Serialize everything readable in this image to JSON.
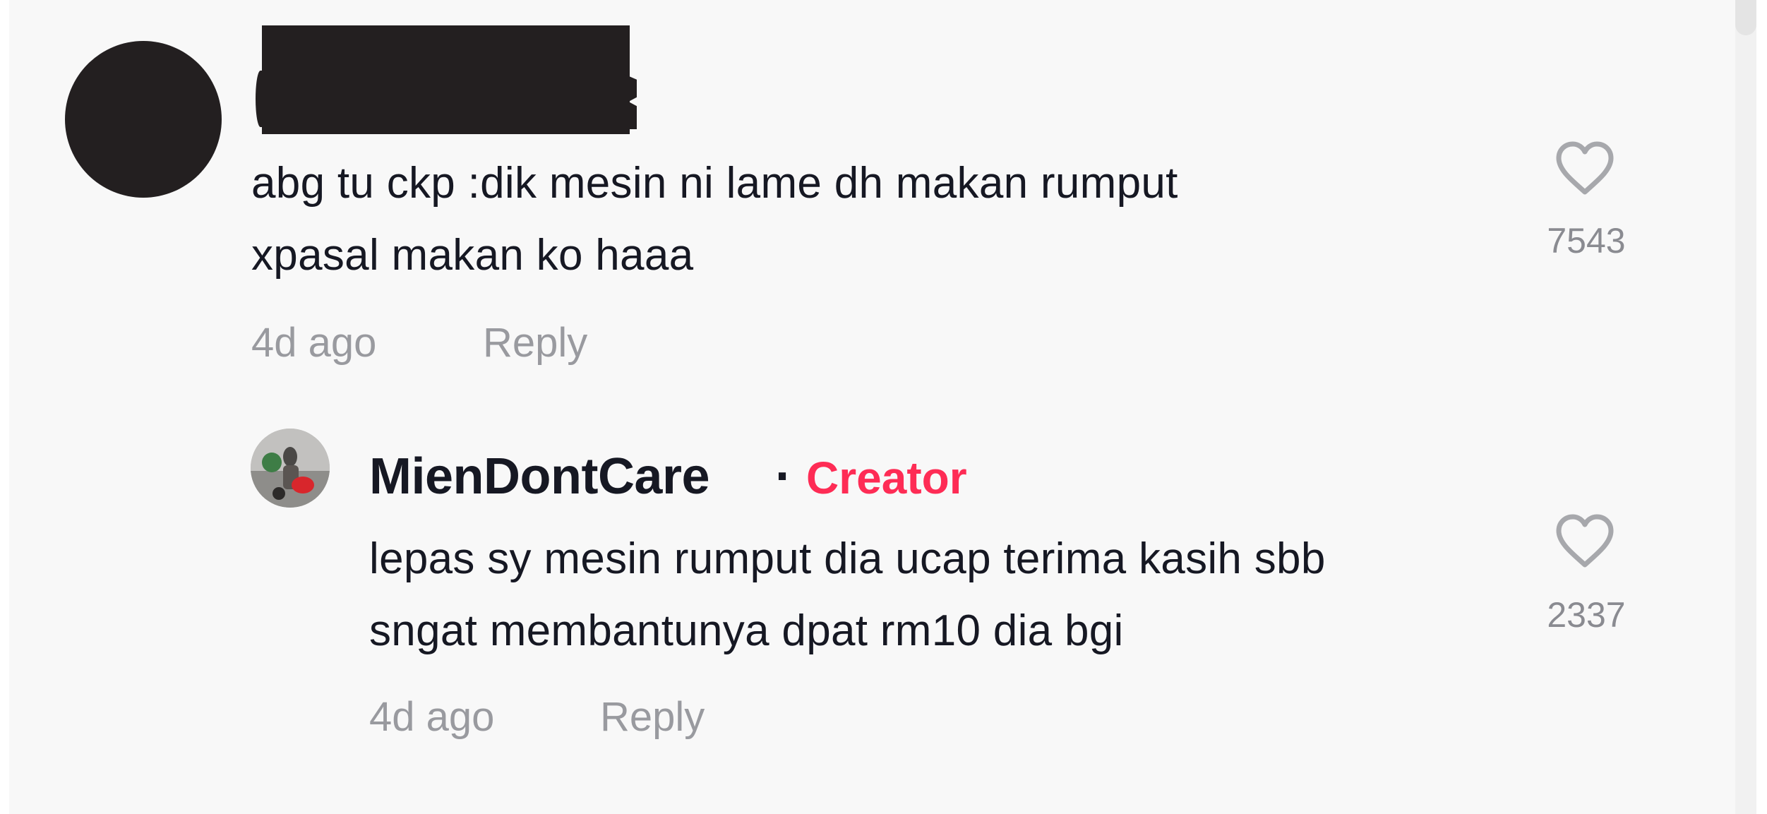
{
  "comments": [
    {
      "author_redacted": true,
      "text_lines": [
        "abg tu ckp :dik mesin ni lame dh makan rumput",
        "xpasal makan ko haaa"
      ],
      "time": "4d ago",
      "reply_label": "Reply",
      "likes": "7543"
    }
  ],
  "reply": {
    "username": "MienDontCare",
    "separator": "·",
    "badge": "Creator",
    "text_lines": [
      "lepas sy mesin rumput dia ucap terima kasih sbb",
      "sngat membantunya dpat rm10 dia bgi"
    ],
    "time": "4d ago",
    "reply_label": "Reply",
    "likes": "2337"
  },
  "icons": {
    "like": "heart-outline-icon"
  },
  "colors": {
    "creator_badge": "#fe2c55",
    "text": "#161823",
    "meta": "#999a9f",
    "background": "#f8f8f8"
  }
}
